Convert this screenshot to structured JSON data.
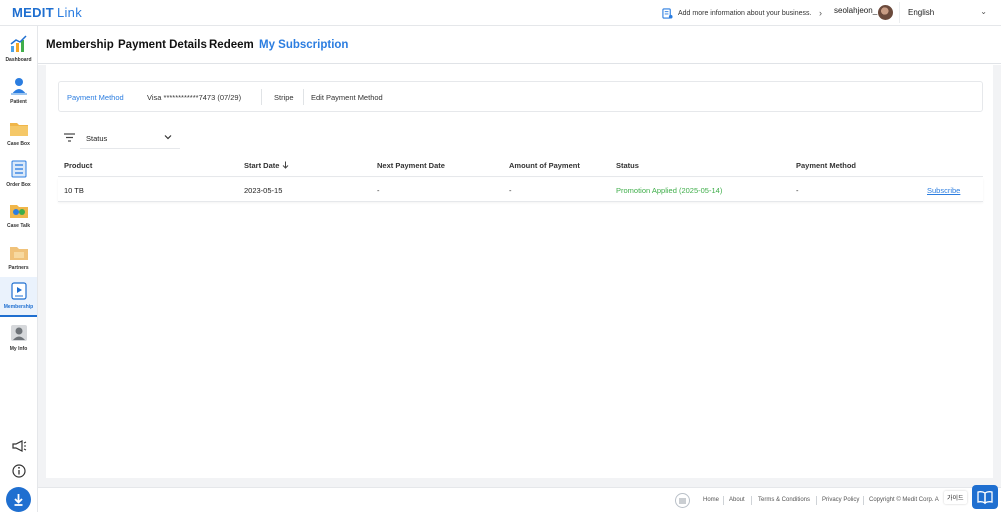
{
  "app": {
    "brand": "MEDIT",
    "brand_suffix": "Link"
  },
  "topbar": {
    "business_banner": "Add more information about your business.",
    "username": "seolahjeon_",
    "language": "English"
  },
  "sidebar": {
    "items": [
      {
        "label": "Dashboard"
      },
      {
        "label": "Patient"
      },
      {
        "label": "Case Box"
      },
      {
        "label": "Order Box"
      },
      {
        "label": "Case Talk"
      },
      {
        "label": "Partners"
      },
      {
        "label": "Membership"
      },
      {
        "label": "My Info"
      }
    ]
  },
  "tabs": [
    "Membership",
    "Payment Details",
    "Redeem",
    "My Subscription"
  ],
  "payment_method": {
    "label": "Payment Method",
    "card": "Visa ************7473 (07/29)",
    "provider": "Stripe",
    "edit_label": "Edit Payment Method"
  },
  "filter": {
    "selected": "Status"
  },
  "table": {
    "headers": [
      "Product",
      "Start Date",
      "Next Payment Date",
      "Amount of Payment",
      "Status",
      "Payment Method"
    ],
    "rows": [
      {
        "product": "10 TB",
        "start_date": "2023-05-15",
        "next_payment": "-",
        "amount": "-",
        "status": "Promotion Applied (2025-05-14)",
        "payment_method": "-",
        "action": "Subscribe"
      }
    ]
  },
  "footer": {
    "links": [
      "Home",
      "About",
      "Terms & Conditions",
      "Privacy Policy"
    ],
    "copyright": "Copyright © Medit Corp. A"
  },
  "widgets": {
    "guide_badge": "가이드"
  },
  "colors": {
    "accent": "#1f6fd0",
    "status_green": "#3fae4a"
  }
}
